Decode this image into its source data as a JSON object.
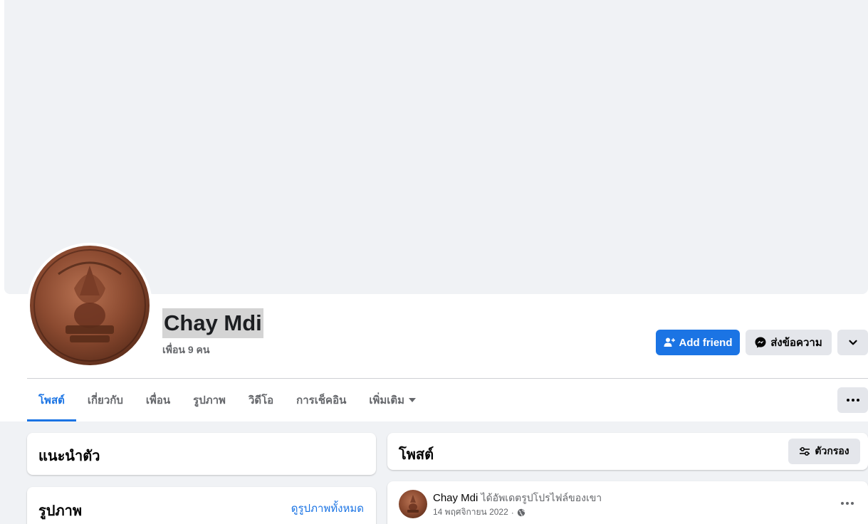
{
  "profile": {
    "name": "Chay Mdi",
    "friends": "เพื่อน 9 คน"
  },
  "actions": {
    "add_friend": "Add friend",
    "message": "ส่งข้อความ"
  },
  "tabs": [
    {
      "label": "โพสต์",
      "active": true
    },
    {
      "label": "เกี่ยวกับ"
    },
    {
      "label": "เพื่อน"
    },
    {
      "label": "รูปภาพ"
    },
    {
      "label": "วิดีโอ"
    },
    {
      "label": "การเช็คอิน"
    },
    {
      "label": "เพิ่มเติม"
    }
  ],
  "intro": {
    "title": "แนะนำตัว"
  },
  "photos": {
    "title": "รูปภาพ",
    "see_all": "ดูรูปภาพทั้งหมด"
  },
  "posts": {
    "title": "โพสต์",
    "filter": "ตัวกรอง"
  },
  "post": {
    "author": "Chay Mdi",
    "action": "ได้อัพเดตรูปโปรไฟล์ของเขา",
    "date": "14 พฤศจิกายน 2022"
  },
  "colors": {
    "accent": "#1b74e4",
    "background": "#f0f2f5"
  }
}
